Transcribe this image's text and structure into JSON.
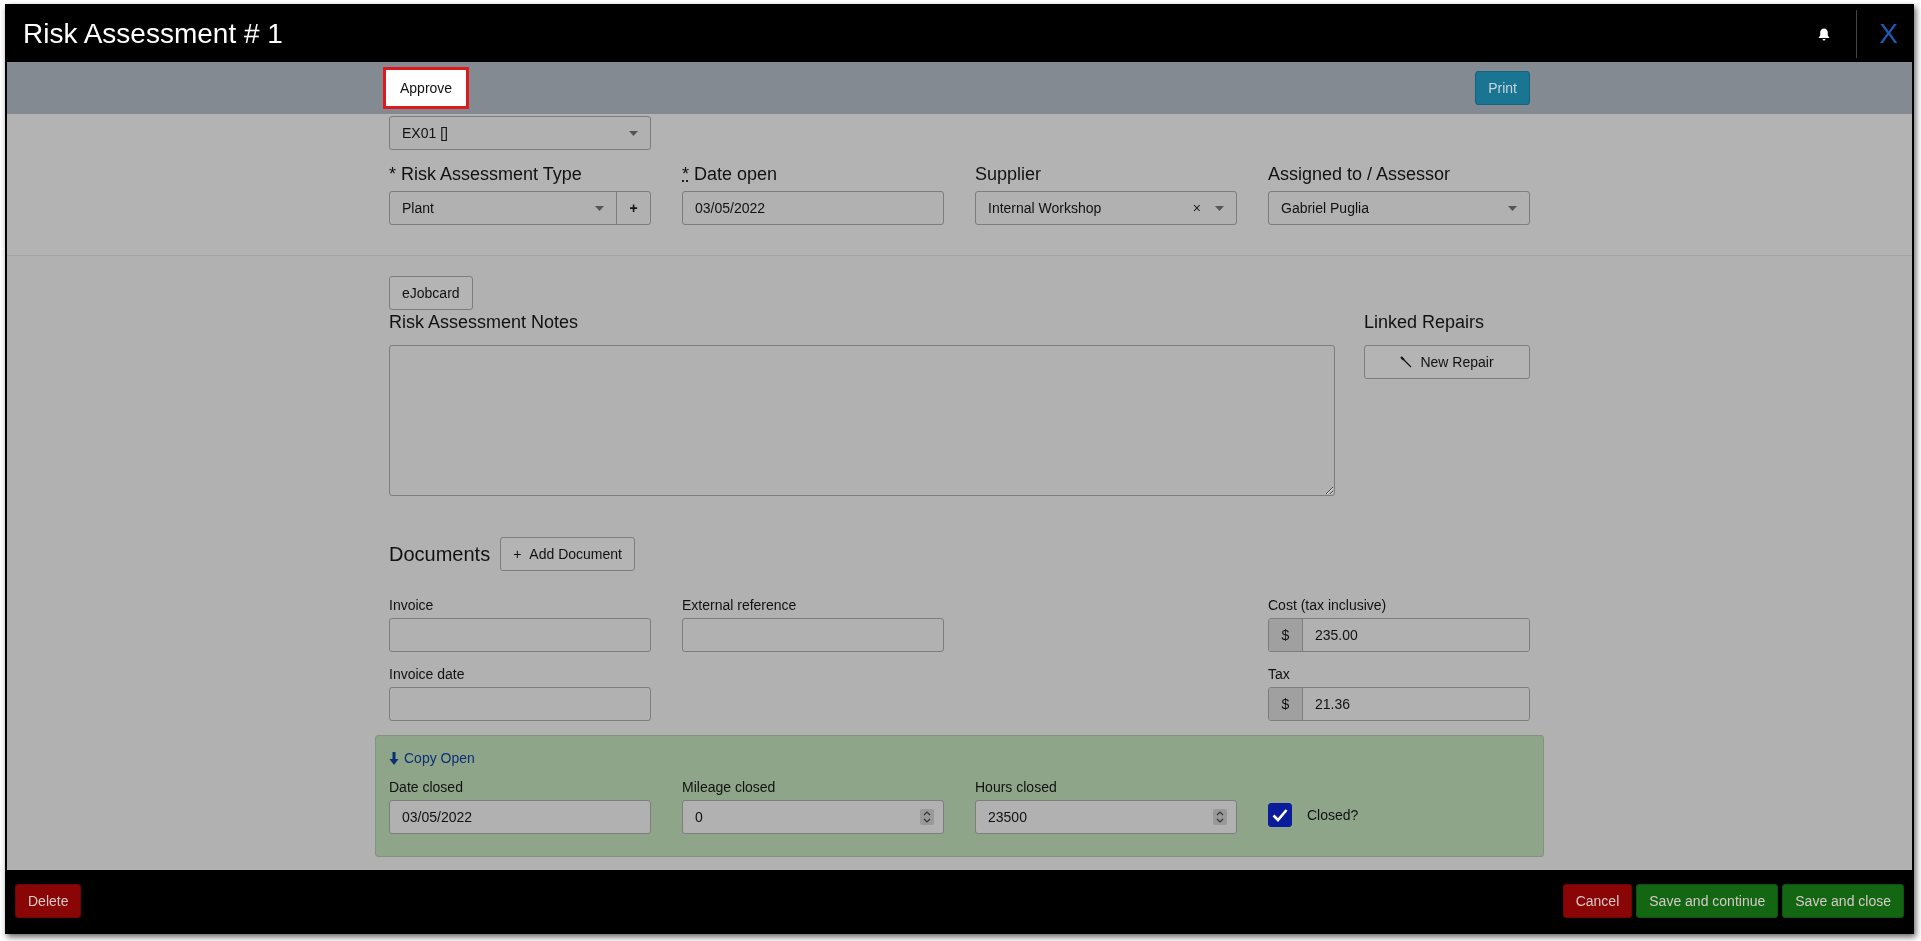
{
  "window": {
    "title": "Risk Assessment # 1",
    "close": "X"
  },
  "toolbar": {
    "approve": {
      "label": "Approve",
      "highlighted": true
    },
    "print": {
      "label": "Print"
    }
  },
  "asset_select": {
    "value": "EX01 []"
  },
  "header_fields": [
    {
      "kind": "select",
      "required_mark": "*",
      "label": "Risk Assessment Type",
      "value": "Plant",
      "add": "+"
    },
    {
      "kind": "input",
      "required_mark": "*",
      "label": "Date open",
      "value": "03/05/2022"
    },
    {
      "kind": "select",
      "label": "Supplier",
      "value": "Internal Workshop",
      "clear": "×"
    },
    {
      "kind": "select",
      "label": "Assigned to / Assessor",
      "value": "Gabriel Puglia"
    }
  ],
  "ejobcard": {
    "label": "eJobcard"
  },
  "notes": {
    "label": "Risk Assessment Notes"
  },
  "linked_repairs": {
    "label": "Linked Repairs",
    "button": "New Repair"
  },
  "documents": {
    "label": "Documents",
    "button": "Add Document",
    "button_icon": "+"
  },
  "invoice": {
    "label": "Invoice"
  },
  "external_reference": {
    "label": "External reference"
  },
  "invoice_date": {
    "label": "Invoice date"
  },
  "cost": {
    "label": "Cost (tax inclusive)",
    "prefix": "$",
    "value": "235.00"
  },
  "tax": {
    "label": "Tax",
    "prefix": "$",
    "value": "21.36"
  },
  "closing": {
    "copy_link": "Copy Open",
    "fields": [
      {
        "kind": "date",
        "label": "Date closed",
        "value": "03/05/2022"
      },
      {
        "kind": "number",
        "label": "Mileage closed",
        "value": "0"
      },
      {
        "kind": "number",
        "label": "Hours closed",
        "value": "23500"
      }
    ],
    "closed": {
      "label": "Closed?",
      "checked": true
    }
  },
  "footer": {
    "left": [
      {
        "label": "Delete",
        "kind": "danger"
      }
    ],
    "right": [
      {
        "label": "Cancel",
        "kind": "danger"
      },
      {
        "label": "Save and continue",
        "kind": "success"
      },
      {
        "label": "Save and close",
        "kind": "success"
      }
    ]
  }
}
